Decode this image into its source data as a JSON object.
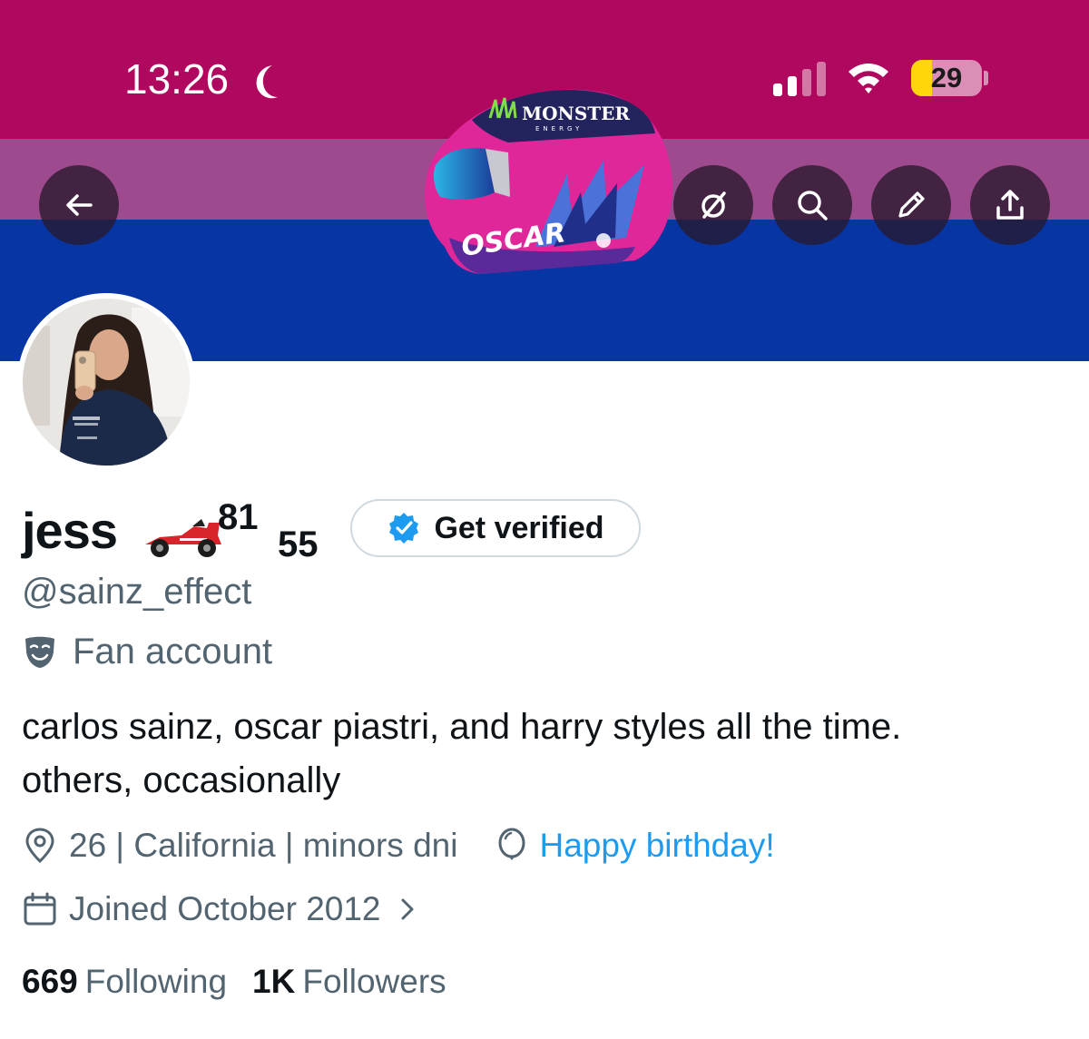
{
  "status_bar": {
    "time": "13:26",
    "battery_level": "29",
    "battery_fraction": 0.29,
    "icons": [
      "moon-icon",
      "cellular-signal-icon",
      "wifi-icon",
      "battery-icon"
    ]
  },
  "header": {
    "banner_colors": [
      "#b0085e",
      "#9e4a8f",
      "#0735a3"
    ],
    "helmet_texts": {
      "sponsor": "MONSTER",
      "sponsor_sub": "ENERGY",
      "driver": "OSCAR"
    },
    "nav_icons": [
      "back-arrow-icon",
      "grok-icon",
      "search-icon",
      "edit-icon",
      "share-icon"
    ]
  },
  "profile": {
    "display_name": "jess",
    "name_emoji": "racing-car-emoji",
    "number_1": "81",
    "number_2": "55",
    "verify_label": "Get verified",
    "handle": "@sainz_effect",
    "category": "Fan account",
    "bio_line_1": "carlos sainz, oscar piastri, and harry styles all the time.",
    "bio_line_2": "others, occasionally",
    "location": "26 | California | minors dni",
    "birthday": "Happy birthday!",
    "joined": "Joined October 2012",
    "following_count": "669",
    "following_label": "Following",
    "followers_count": "1K",
    "followers_label": "Followers"
  },
  "colors": {
    "text_primary": "#0f1419",
    "text_secondary": "#536471",
    "link_blue": "#1d9bf0",
    "verify_badge": "#1d9bf0"
  }
}
